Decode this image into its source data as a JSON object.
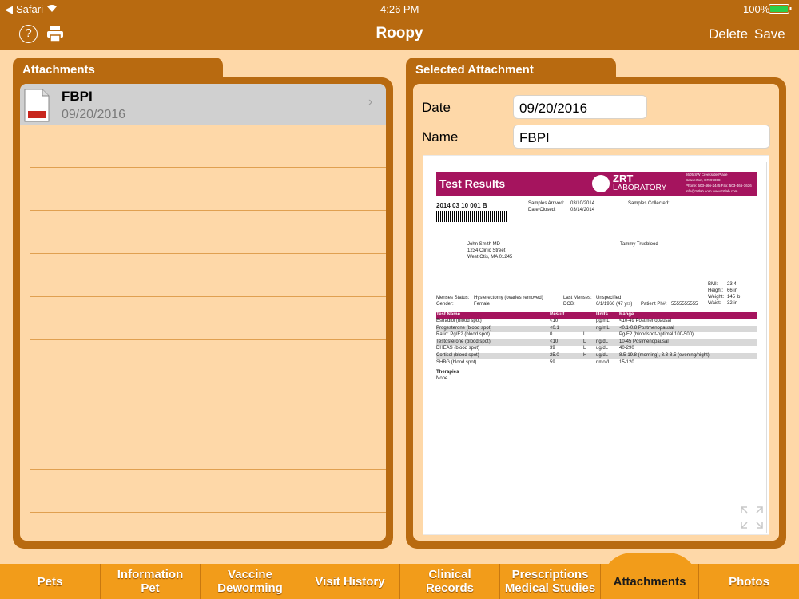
{
  "status": {
    "carrier": "Safari",
    "time": "4:26 PM",
    "battery": "100%"
  },
  "nav": {
    "title": "Roopy",
    "help": "?",
    "delete": "Delete",
    "save": "Save"
  },
  "left": {
    "tab": "Attachments",
    "item": {
      "name": "FBPI",
      "date": "09/20/2016",
      "icon": "PDF"
    }
  },
  "right": {
    "tab": "Selected Attachment",
    "date_label": "Date",
    "date_value": "09/20/2016",
    "name_label": "Name",
    "name_value": "FBPI"
  },
  "doc": {
    "header": "Test Results",
    "lab": "ZRT",
    "lab2": "LABORATORY",
    "addr1": "8605 SW Creekside Place",
    "addr2": "Beaverton, OR 97008",
    "addr3": "Phone: 503-466-2445  Fax: 503-466-1636",
    "addr4": "info@zrtlab.com              www.zrtlab.com",
    "id": "2014 03 10 001 B",
    "arrived_l": "Samples Arrived:",
    "arrived": "03/10/2014",
    "closed_l": "Date Closed:",
    "closed": "03/14/2014",
    "collected_l": "Samples Collected:",
    "dr1": "John Smith MD",
    "dr2": "1234 Clinic Street",
    "dr3": "West Otis, MA 01245",
    "patient": "Tammy Trueblood",
    "bmi_l": "BMI:",
    "bmi": "23.4",
    "height_l": "Height:",
    "height": "66 in",
    "weight_l": "Weight:",
    "weight": "145 lb",
    "waist_l": "Waist:",
    "waist": "32 in",
    "menses_l": "Menses Status:",
    "menses": "Hysterectomy (ovaries removed)",
    "gender_l": "Gender:",
    "gender": "Female",
    "last_l": "Last Menses:",
    "last": "Unspecified",
    "dob_l": "DOB:",
    "dob": "6/1/1966 (47 yrs)",
    "ph_l": "Patient Ph#:",
    "ph": "5555555555",
    "th": [
      "Test Name",
      "Result",
      "",
      "Units",
      "Range"
    ],
    "rows": [
      [
        "Estradiol (blood spot)",
        "<10",
        "",
        "pg/mL",
        "<10-49  Postmenopausal"
      ],
      [
        "Progesterone (blood spot)",
        "<0.1",
        "",
        "ng/mL",
        "<0.1-0.8  Postmenopausal"
      ],
      [
        "Ratio: Pg/E2 (blood spot)",
        "0",
        "L",
        "",
        "Pg/E2 (bloodspot-optimal 100-500)"
      ],
      [
        "Testosterone (blood spot)",
        "<10",
        "L",
        "ng/dL",
        "10-45  Postmenopausal"
      ],
      [
        "DHEAS (blood spot)",
        "39",
        "L",
        "ug/dL",
        "40-290"
      ],
      [
        "Cortisol (blood spot)",
        "25.0",
        "H",
        "ug/dL",
        "8.5-19.8 (morning), 3.3-8.5 (evening/night)"
      ],
      [
        "SHBG (blood spot)",
        "59",
        "",
        "nmol/L",
        "15-120"
      ]
    ],
    "therapies_l": "Therapies",
    "therapies": "None"
  },
  "tabs": [
    [
      "Pets"
    ],
    [
      "Information",
      "Pet"
    ],
    [
      "Vaccine",
      "Deworming"
    ],
    [
      "Visit History"
    ],
    [
      "Clinical",
      "Records"
    ],
    [
      "Prescriptions",
      "Medical Studies"
    ],
    [
      "Attachments"
    ],
    [
      "Photos"
    ]
  ],
  "colors": {
    "bar": "#b86a10",
    "tab_bar": "#f29c1a",
    "bg": "#fed8a8",
    "doc_header": "#a5145e"
  }
}
